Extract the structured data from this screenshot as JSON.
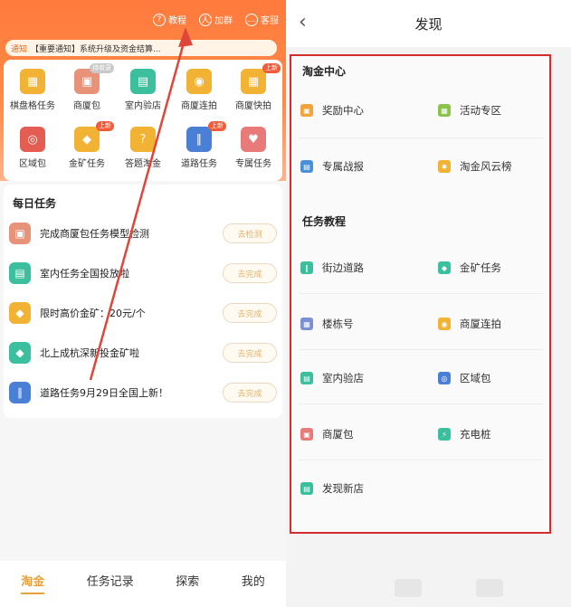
{
  "left": {
    "topbar": [
      {
        "icon": "question-icon",
        "glyph": "?",
        "label": "教程"
      },
      {
        "icon": "person-icon",
        "glyph": "人",
        "label": "加群"
      },
      {
        "icon": "chat-icon",
        "glyph": "…",
        "label": "客服"
      }
    ],
    "notice": {
      "tag": "通知",
      "text": "【重要通知】系统升级及资金结算..."
    },
    "grid": [
      {
        "label": "棋盘格任务",
        "glyph": "▦",
        "color": "#f2b233",
        "badge": ""
      },
      {
        "label": "商厦包",
        "glyph": "▣",
        "color": "#e8927a",
        "badge": "待收录"
      },
      {
        "label": "室内验店",
        "glyph": "▤",
        "color": "#3bbf9c",
        "badge": ""
      },
      {
        "label": "商厦连拍",
        "glyph": "◉",
        "color": "#f2b233",
        "badge": ""
      },
      {
        "label": "商厦快拍",
        "glyph": "▦",
        "color": "#f2b233",
        "badge": "上新"
      },
      {
        "label": "区域包",
        "glyph": "◎",
        "color": "#e35d52",
        "badge": ""
      },
      {
        "label": "金矿任务",
        "glyph": "◆",
        "color": "#f2b233",
        "badge": "上新"
      },
      {
        "label": "答题淘金",
        "glyph": "?",
        "color": "#f2b233",
        "badge": ""
      },
      {
        "label": "道路任务",
        "glyph": "∥",
        "color": "#4a7fd6",
        "badge": "上新"
      },
      {
        "label": "专属任务",
        "glyph": "♥",
        "color": "#e87a7a",
        "badge": ""
      }
    ],
    "daily_title": "每日任务",
    "tasks": [
      {
        "text": "完成商厦包任务模型检测",
        "button": "去检测",
        "glyph": "▣",
        "color": "#e8927a"
      },
      {
        "text": "室内任务全国投放啦",
        "button": "去完成",
        "glyph": "▤",
        "color": "#3bbf9c"
      },
      {
        "text": "限时高价金矿：20元/个",
        "button": "去完成",
        "glyph": "◆",
        "color": "#f2b233"
      },
      {
        "text": "北上成杭深新投金矿啦",
        "button": "去完成",
        "glyph": "◆",
        "color": "#3bbf9c"
      },
      {
        "text": "道路任务9月29日全国上新！",
        "button": "去完成",
        "glyph": "∥",
        "color": "#4a7fd6"
      }
    ],
    "nav": [
      "淘金",
      "任务记录",
      "探索",
      "我的"
    ]
  },
  "right": {
    "back": "‹",
    "title": "发现",
    "section1": "淘金中心",
    "items1": [
      {
        "label": "奖励中心",
        "glyph": "▣",
        "color": "#f2a33a"
      },
      {
        "label": "活动专区",
        "glyph": "▦",
        "color": "#8bc34a"
      },
      {
        "label": "专属战报",
        "glyph": "▤",
        "color": "#4a90d9"
      },
      {
        "label": "淘金风云榜",
        "glyph": "✹",
        "color": "#f2b233"
      }
    ],
    "section2": "任务教程",
    "items2": [
      {
        "label": "街边道路",
        "glyph": "∥",
        "color": "#3bbf9c"
      },
      {
        "label": "金矿任务",
        "glyph": "◆",
        "color": "#3bbf9c"
      },
      {
        "label": "楼栋号",
        "glyph": "▦",
        "color": "#7b8fd6"
      },
      {
        "label": "商厦连拍",
        "glyph": "◉",
        "color": "#f2b233"
      },
      {
        "label": "室内验店",
        "glyph": "▤",
        "color": "#3bbf9c"
      },
      {
        "label": "区域包",
        "glyph": "◎",
        "color": "#4a7fd6"
      },
      {
        "label": "商厦包",
        "glyph": "▣",
        "color": "#e87a7a"
      },
      {
        "label": "充电桩",
        "glyph": "⚡",
        "color": "#3bbf9c"
      },
      {
        "label": "发现新店",
        "glyph": "▤",
        "color": "#3bbf9c"
      }
    ]
  }
}
